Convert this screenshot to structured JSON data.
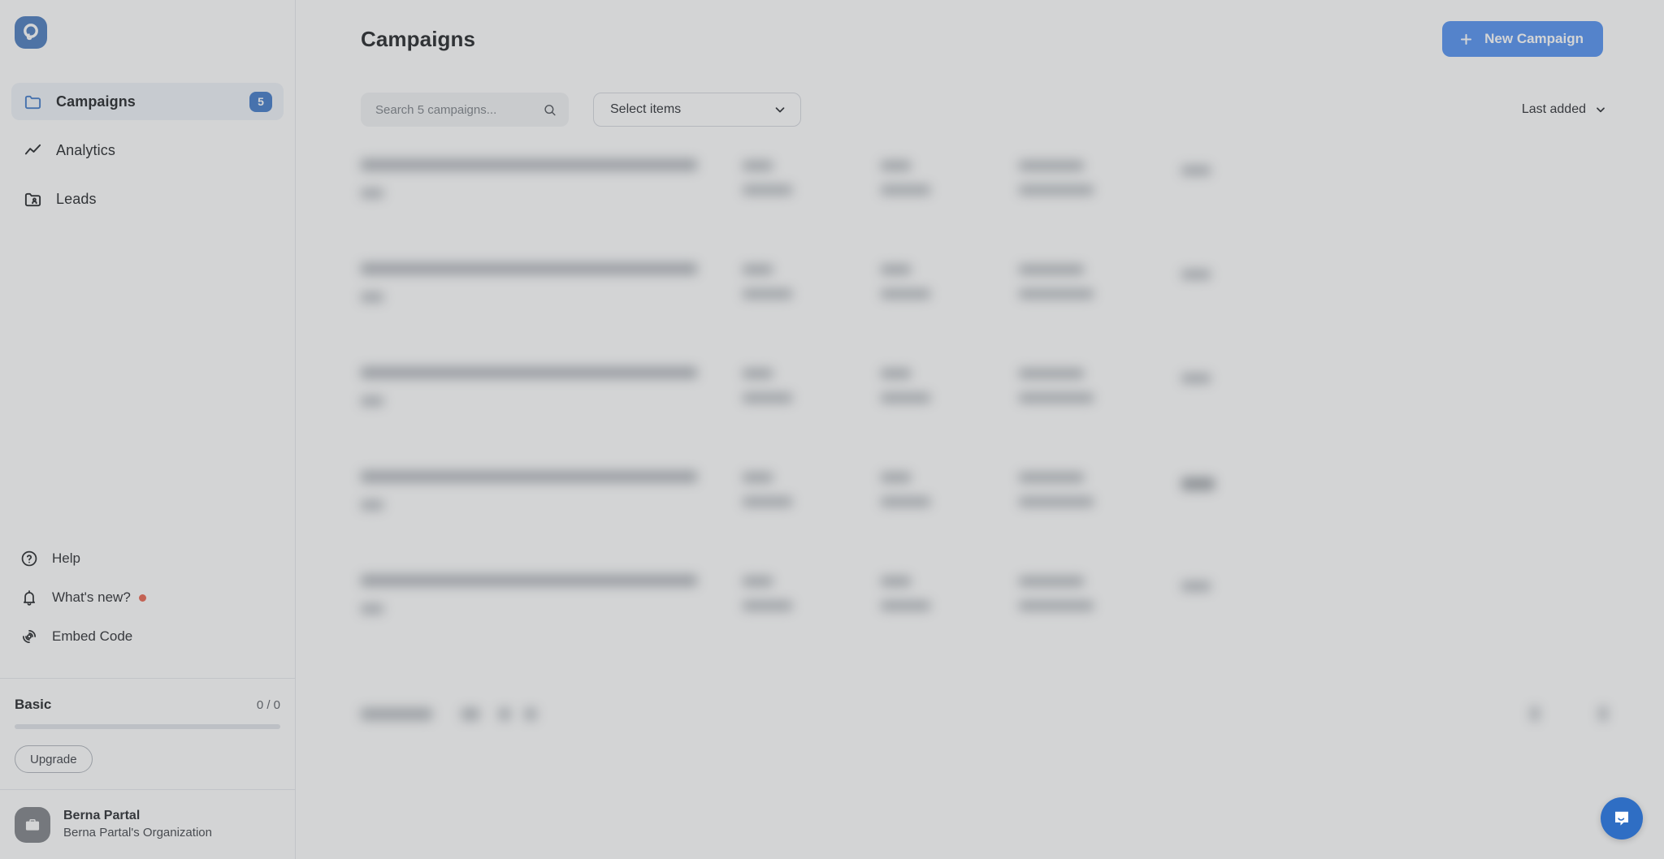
{
  "app": {
    "logo_name": "rocket-logo",
    "overlay_tint": "#7a7c80"
  },
  "sidebar": {
    "nav": [
      {
        "label": "Campaigns",
        "icon": "folder-icon",
        "badge": "5",
        "active": true
      },
      {
        "label": "Analytics",
        "icon": "line-chart-icon",
        "badge": "",
        "active": false
      },
      {
        "label": "Leads",
        "icon": "folder-user-icon",
        "badge": "",
        "active": false
      }
    ],
    "utility": [
      {
        "label": "Help",
        "icon": "question-circle-icon",
        "dot": false
      },
      {
        "label": "What's new?",
        "icon": "bell-icon",
        "dot": true
      },
      {
        "label": "Embed Code",
        "icon": "broadcast-icon",
        "dot": false
      }
    ],
    "plan": {
      "name": "Basic",
      "usage": "0 / 0",
      "progress_percent": 0,
      "upgrade_label": "Upgrade"
    },
    "user": {
      "name": "Berna Partal",
      "organization": "Berna Partal's Organization",
      "avatar_icon": "briefcase-icon"
    },
    "accent_color": "#2f6ec4",
    "notification_dot_color": "#e8553f"
  },
  "header": {
    "title": "Campaigns",
    "new_campaign_label": "New Campaign",
    "new_campaign_icon": "plus-icon",
    "new_campaign_color": "#4287f0",
    "highlighted": true
  },
  "toolbar": {
    "search_placeholder": "Search 5 campaigns...",
    "search_value": "",
    "search_icon": "search-icon",
    "select_items_label": "Select items",
    "select_chevron_icon": "chevron-down-icon",
    "sort_label": "Last added",
    "sort_chevron_icon": "chevron-down-icon"
  },
  "content": {
    "blurred": true,
    "row_count": 5
  },
  "widgets": {
    "intercom_label": "chat-bubble-icon",
    "intercom_color": "#2f6ec4"
  }
}
